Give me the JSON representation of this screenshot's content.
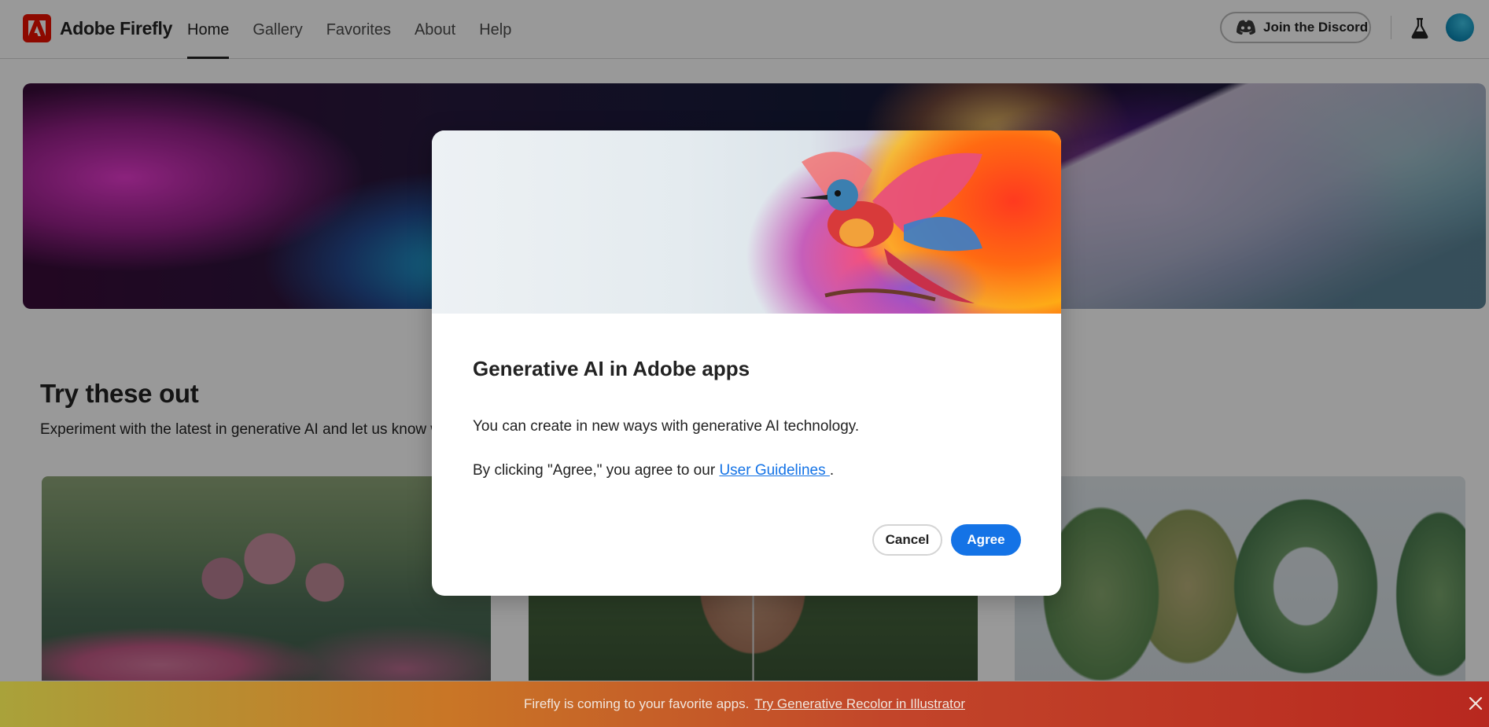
{
  "header": {
    "brand_name": "Adobe Firefly",
    "nav": [
      "Home",
      "Gallery",
      "Favorites",
      "About",
      "Help"
    ],
    "active_nav": "Home",
    "discord_label": "Join the Discord",
    "icons": [
      "adobe-logo-icon",
      "discord-icon",
      "labs-flask-icon",
      "avatar"
    ]
  },
  "content": {
    "section_title": "Try these out",
    "section_subtitle": "Experiment with the latest in generative AI and let us know w"
  },
  "modal": {
    "title": "Generative AI in Adobe apps",
    "body_line1": "You can create in new ways with generative AI technology.",
    "body_line2_prefix": "By clicking \"Agree,\" you agree to our ",
    "body_line2_link": "User Guidelines ",
    "body_line2_suffix": ".",
    "cancel_label": "Cancel",
    "agree_label": "Agree"
  },
  "banner": {
    "text": "Firefly is coming to your favorite apps.",
    "link": "Try Generative Recolor in Illustrator"
  },
  "colors": {
    "accent_blue": "#1473e6",
    "adobe_red": "#eb1000"
  }
}
